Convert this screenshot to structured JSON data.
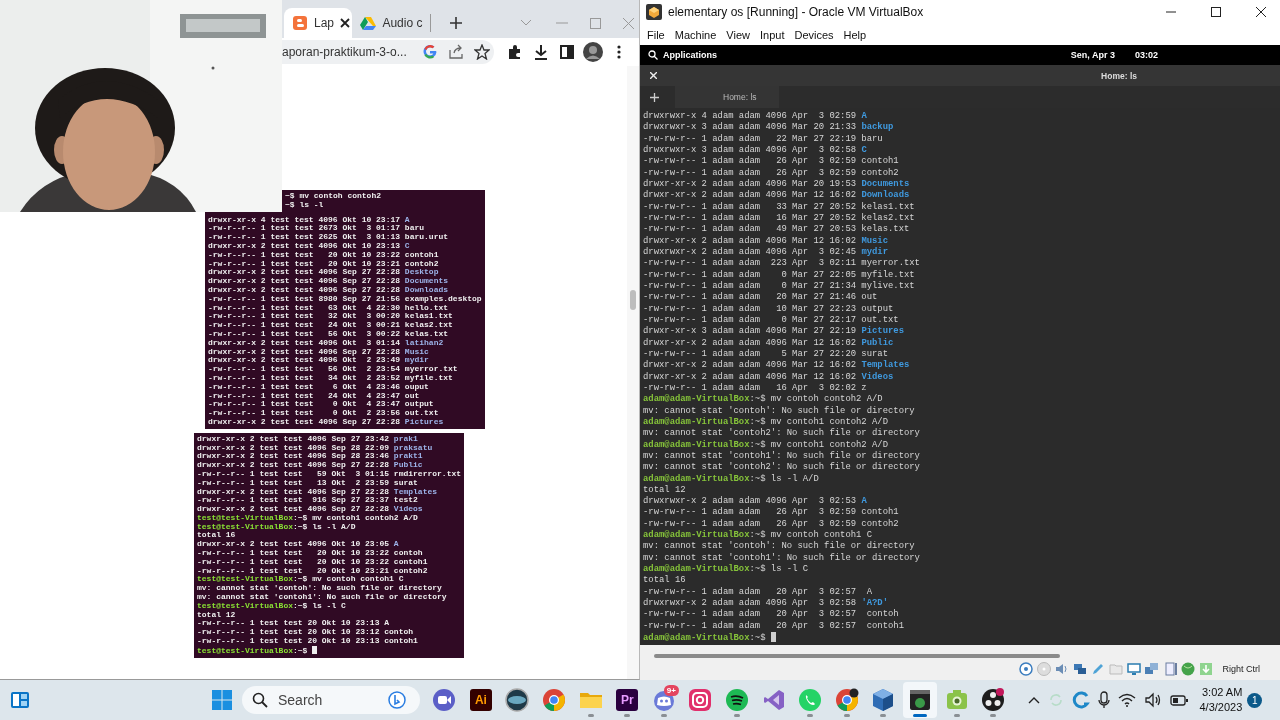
{
  "browser": {
    "tabs": [
      {
        "label": "Lap",
        "selected": true
      },
      {
        "label": "Audio c",
        "selected": false
      }
    ],
    "address": "aporan-praktikum-3-o...",
    "screenshots": [
      {
        "lines": [
          {
            "kind": "partial",
            "text": "~$ mv contoh contoh2"
          },
          {
            "kind": "partial",
            "text": "~$ ls -l"
          },
          {
            "kind": "dir",
            "text": "drwxr-xr-x 4 test test 4096 Okt 10 23:17",
            "name": "A"
          },
          {
            "kind": "output",
            "text": "-rw-r--r-- 1 test test 2673 Okt  3 01:17 baru"
          },
          {
            "kind": "output",
            "text": "-rw-r--r-- 1 test test 2625 Okt  3 01:13 baru.urut"
          },
          {
            "kind": "dir",
            "text": "drwxr-xr-x 2 test test 4096 Okt 10 23:13",
            "name": "C"
          },
          {
            "kind": "output",
            "text": "-rw-r--r-- 1 test test   20 Okt 10 23:22 contoh1"
          },
          {
            "kind": "output",
            "text": "-rw-r--r-- 1 test test   20 Okt 10 23:21 contoh2"
          },
          {
            "kind": "dir",
            "text": "drwxr-xr-x 2 test test 4096 Sep 27 22:28",
            "name": "Desktop"
          },
          {
            "kind": "dir",
            "text": "drwxr-xr-x 2 test test 4096 Sep 27 22:28",
            "name": "Documents"
          },
          {
            "kind": "dir",
            "text": "drwxr-xr-x 2 test test 4096 Sep 27 22:28",
            "name": "Downloads"
          },
          {
            "kind": "output",
            "text": "-rw-r--r-- 1 test test 8980 Sep 27 21:56 examples.desktop"
          },
          {
            "kind": "output",
            "text": "-rw-r--r-- 1 test test   63 Okt  4 22:30 hello.txt"
          },
          {
            "kind": "output",
            "text": "-rw-r--r-- 1 test test   32 Okt  3 00:20 kelas1.txt"
          },
          {
            "kind": "output",
            "text": "-rw-r--r-- 1 test test   24 Okt  3 00:21 kelas2.txt"
          },
          {
            "kind": "output",
            "text": "-rw-r--r-- 1 test test   56 Okt  3 00:22 kelas.txt"
          },
          {
            "kind": "dir",
            "text": "drwxr-xr-x 2 test test 4096 Okt  3 01:14",
            "name": "latihan2"
          },
          {
            "kind": "dir",
            "text": "drwxr-xr-x 2 test test 4096 Sep 27 22:28",
            "name": "Music"
          },
          {
            "kind": "dir",
            "text": "drwxr-xr-x 2 test test 4096 Okt  2 23:49",
            "name": "mydir"
          },
          {
            "kind": "output",
            "text": "-rw-r--r-- 1 test test   56 Okt  2 23:54 myerror.txt"
          },
          {
            "kind": "output",
            "text": "-rw-r--r-- 1 test test   34 Okt  2 23:52 myfile.txt"
          },
          {
            "kind": "output",
            "text": "-rw-r--r-- 1 test test    6 Okt  4 23:46 ouput"
          },
          {
            "kind": "output",
            "text": "-rw-r--r-- 1 test test   24 Okt  4 23:47 out"
          },
          {
            "kind": "output",
            "text": "-rw-r--r-- 1 test test    0 Okt  4 23:47 output"
          },
          {
            "kind": "output",
            "text": "-rw-r--r-- 1 test test    0 Okt  2 23:56 out.txt"
          },
          {
            "kind": "dir",
            "text": "drwxr-xr-x 2 test test 4096 Sep 27 22:28",
            "name": "Pictures"
          }
        ]
      },
      {
        "lines": [
          {
            "kind": "dir",
            "text": "drwxr-xr-x 2 test test 4096 Sep 27 23:42",
            "name": "prak1"
          },
          {
            "kind": "dir",
            "text": "drwxr-xr-x 2 test test 4096 Sep 28 22:09",
            "name": "praksatu"
          },
          {
            "kind": "dir",
            "text": "drwxr-xr-x 2 test test 4096 Sep 28 23:46",
            "name": "prakt1"
          },
          {
            "kind": "dir",
            "text": "drwxr-xr-x 2 test test 4096 Sep 27 22:28",
            "name": "Public"
          },
          {
            "kind": "output",
            "text": "-rw-r--r-- 1 test test   59 Okt  3 01:15 rmdirerror.txt"
          },
          {
            "kind": "output",
            "text": "-rw-r--r-- 1 test test   13 Okt  2 23:59 surat"
          },
          {
            "kind": "dir",
            "text": "drwxr-xr-x 2 test test 4096 Sep 27 22:28",
            "name": "Templates"
          },
          {
            "kind": "output",
            "text": "-rw-r--r-- 1 test test  916 Sep 27 23:37 test2"
          },
          {
            "kind": "dir",
            "text": "drwxr-xr-x 2 test test 4096 Sep 27 22:28",
            "name": "Videos"
          },
          {
            "kind": "prompt",
            "user": "test@test-VirtualBox",
            "text": ":~$ mv contoh1 contoh2 A/D"
          },
          {
            "kind": "prompt",
            "user": "test@test-VirtualBox",
            "text": ":~$ ls -l A/D"
          },
          {
            "kind": "output",
            "text": "total 16"
          },
          {
            "kind": "dir",
            "text": "drwxr-xr-x 2 test test 4096 Okt 10 23:05",
            "name": "A"
          },
          {
            "kind": "output",
            "text": "-rw-r--r-- 1 test test   20 Okt 10 23:22 contoh"
          },
          {
            "kind": "output",
            "text": "-rw-r--r-- 1 test test   20 Okt 10 23:22 contoh1"
          },
          {
            "kind": "output",
            "text": "-rw-r--r-- 1 test test   20 Okt 10 23:21 contoh2"
          },
          {
            "kind": "prompt",
            "user": "test@test-VirtualBox",
            "text": ":~$ mv contoh contoh1 C"
          },
          {
            "kind": "output",
            "text": "mv: cannot stat 'contoh': No such file or directory"
          },
          {
            "kind": "output",
            "text": "mv: cannot stat 'contoh1': No such file or directory"
          },
          {
            "kind": "prompt",
            "user": "test@test-VirtualBox",
            "text": ":~$ ls -l C"
          },
          {
            "kind": "output",
            "text": "total 12"
          },
          {
            "kind": "output",
            "text": "-rw-r--r-- 1 test test 20 Okt 10 23:13 A"
          },
          {
            "kind": "output",
            "text": "-rw-r--r-- 1 test test 20 Okt 10 23:12 contoh"
          },
          {
            "kind": "output",
            "text": "-rw-r--r-- 1 test test 20 Okt 10 23:13 contoh1"
          },
          {
            "kind": "prompt",
            "user": "test@test-VirtualBox",
            "text": ":~$ ",
            "cursor": true
          }
        ]
      }
    ]
  },
  "vm_window": {
    "title": "elementary os [Running] - Oracle VM VirtualBox",
    "menu": [
      "File",
      "Machine",
      "View",
      "Input",
      "Devices",
      "Help"
    ],
    "panel": {
      "applications": "Applications",
      "date": "Sen, Apr 3",
      "time": "03:02"
    },
    "terminal": {
      "title": "Home: ls",
      "tabs": [
        {
          "label": "Home: ls",
          "selected": true
        }
      ],
      "lines": [
        {
          "kind": "dir",
          "text": "drwxrwxr-x 4 adam adam 4096 Apr  3 02:59",
          "name": "A"
        },
        {
          "kind": "dir",
          "text": "drwxrwxr-x 3 adam adam 4096 Mar 20 21:33",
          "name": "backup"
        },
        {
          "kind": "output",
          "text": "-rw-rw-r-- 1 adam adam   22 Mar 27 22:19 baru"
        },
        {
          "kind": "dir",
          "text": "drwxrwxr-x 3 adam adam 4096 Apr  3 02:58",
          "name": "C"
        },
        {
          "kind": "output",
          "text": "-rw-rw-r-- 1 adam adam   26 Apr  3 02:59 contoh1"
        },
        {
          "kind": "output",
          "text": "-rw-rw-r-- 1 adam adam   26 Apr  3 02:59 contoh2"
        },
        {
          "kind": "dir",
          "text": "drwxr-xr-x 2 adam adam 4096 Mar 20 19:53",
          "name": "Documents"
        },
        {
          "kind": "dir",
          "text": "drwxr-xr-x 2 adam adam 4096 Mar 12 16:02",
          "name": "Downloads"
        },
        {
          "kind": "output",
          "text": "-rw-rw-r-- 1 adam adam   33 Mar 27 20:52 kelas1.txt"
        },
        {
          "kind": "output",
          "text": "-rw-rw-r-- 1 adam adam   16 Mar 27 20:52 kelas2.txt"
        },
        {
          "kind": "output",
          "text": "-rw-rw-r-- 1 adam adam   49 Mar 27 20:53 kelas.txt"
        },
        {
          "kind": "dir",
          "text": "drwxr-xr-x 2 adam adam 4096 Mar 12 16:02",
          "name": "Music"
        },
        {
          "kind": "dir",
          "text": "drwxrwxr-x 2 adam adam 4096 Apr  3 02:45",
          "name": "mydir"
        },
        {
          "kind": "output",
          "text": "-rw-rw-r-- 1 adam adam  223 Apr  3 02:11 myerror.txt"
        },
        {
          "kind": "output",
          "text": "-rw-rw-r-- 1 adam adam    0 Mar 27 22:05 myfile.txt"
        },
        {
          "kind": "output",
          "text": "-rw-rw-r-- 1 adam adam    0 Mar 27 21:34 mylive.txt"
        },
        {
          "kind": "output",
          "text": "-rw-rw-r-- 1 adam adam   20 Mar 27 21:46 out"
        },
        {
          "kind": "output",
          "text": "-rw-rw-r-- 1 adam adam   10 Mar 27 22:23 output"
        },
        {
          "kind": "output",
          "text": "-rw-rw-r-- 1 adam adam    0 Mar 27 22:17 out.txt"
        },
        {
          "kind": "dir",
          "text": "drwxr-xr-x 3 adam adam 4096 Mar 27 22:19",
          "name": "Pictures"
        },
        {
          "kind": "dir",
          "text": "drwxr-xr-x 2 adam adam 4096 Mar 12 16:02",
          "name": "Public"
        },
        {
          "kind": "output",
          "text": "-rw-rw-r-- 1 adam adam    5 Mar 27 22:20 surat"
        },
        {
          "kind": "dir",
          "text": "drwxr-xr-x 2 adam adam 4096 Mar 12 16:02",
          "name": "Templates"
        },
        {
          "kind": "dir",
          "text": "drwxr-xr-x 2 adam adam 4096 Mar 12 16:02",
          "name": "Videos"
        },
        {
          "kind": "output",
          "text": "-rw-rw-r-- 1 adam adam   16 Apr  3 02:02 z"
        },
        {
          "kind": "prompt",
          "user": "adam@adam-VirtualBox",
          "text": ":~$ mv contoh contoh2 A/D"
        },
        {
          "kind": "output",
          "text": "mv: cannot stat 'contoh': No such file or directory"
        },
        {
          "kind": "prompt",
          "user": "adam@adam-VirtualBox",
          "text": ":~$ mv contoh1 contoh2 A/D"
        },
        {
          "kind": "output",
          "text": "mv: cannot stat 'contoh2': No such file or directory"
        },
        {
          "kind": "prompt",
          "user": "adam@adam-VirtualBox",
          "text": ":~$ mv contoh1 contoh2 A/D"
        },
        {
          "kind": "output",
          "text": "mv: cannot stat 'contoh1': No such file or directory"
        },
        {
          "kind": "output",
          "text": "mv: cannot stat 'contoh2': No such file or directory"
        },
        {
          "kind": "prompt",
          "user": "adam@adam-VirtualBox",
          "text": ":~$ ls -l A/D"
        },
        {
          "kind": "output",
          "text": "total 12"
        },
        {
          "kind": "dir",
          "text": "drwxrwxr-x 2 adam adam 4096 Apr  3 02:53",
          "name": "A"
        },
        {
          "kind": "output",
          "text": "-rw-rw-r-- 1 adam adam   26 Apr  3 02:59 contoh1"
        },
        {
          "kind": "output",
          "text": "-rw-rw-r-- 1 adam adam   26 Apr  3 02:59 contoh2"
        },
        {
          "kind": "prompt",
          "user": "adam@adam-VirtualBox",
          "text": ":~$ mv contoh contoh1 C"
        },
        {
          "kind": "output",
          "text": "mv: cannot stat 'contoh': No such file or directory"
        },
        {
          "kind": "output",
          "text": "mv: cannot stat 'contoh1': No such file or directory"
        },
        {
          "kind": "prompt",
          "user": "adam@adam-VirtualBox",
          "text": ":~$ ls -l C"
        },
        {
          "kind": "output",
          "text": "total 16"
        },
        {
          "kind": "output",
          "text": "-rw-rw-r-- 1 adam adam   20 Apr  3 02:57  A"
        },
        {
          "kind": "dir",
          "text": "drwxrwxr-x 2 adam adam 4096 Apr  3 02:58",
          "name": "'A?D'"
        },
        {
          "kind": "output",
          "text": "-rw-rw-r-- 1 adam adam   20 Apr  3 02:57  contoh"
        },
        {
          "kind": "output",
          "text": "-rw-rw-r-- 1 adam adam   20 Apr  3 02:57  contoh1"
        },
        {
          "kind": "prompt",
          "user": "adam@adam-VirtualBox",
          "text": ":~$ ",
          "cursor": true
        }
      ]
    },
    "host_key": "Right Ctrl"
  },
  "taskbar": {
    "search": {
      "placeholder": "Search"
    },
    "apps": [
      {
        "selected": false,
        "running": false
      },
      {
        "label": "Ai",
        "selected": false,
        "running": false
      },
      {
        "selected": false,
        "running": false
      },
      {
        "selected": false,
        "running": false
      },
      {
        "selected": false,
        "running": true
      },
      {
        "label": "Pr",
        "selected": false,
        "running": true
      },
      {
        "badge": "9+",
        "selected": false,
        "running": true
      },
      {
        "selected": false,
        "running": false
      },
      {
        "selected": false,
        "running": true
      },
      {
        "selected": false,
        "running": false
      },
      {
        "selected": false,
        "running": true
      },
      {
        "selected": false,
        "running": true
      },
      {
        "selected": false,
        "running": true
      },
      {
        "selected": true,
        "running": true
      },
      {
        "selected": false,
        "running": true
      },
      {
        "selected": false,
        "running": true
      }
    ],
    "clock": {
      "time": "3:02 AM",
      "date": "4/3/2023"
    },
    "notification_count": "1"
  }
}
